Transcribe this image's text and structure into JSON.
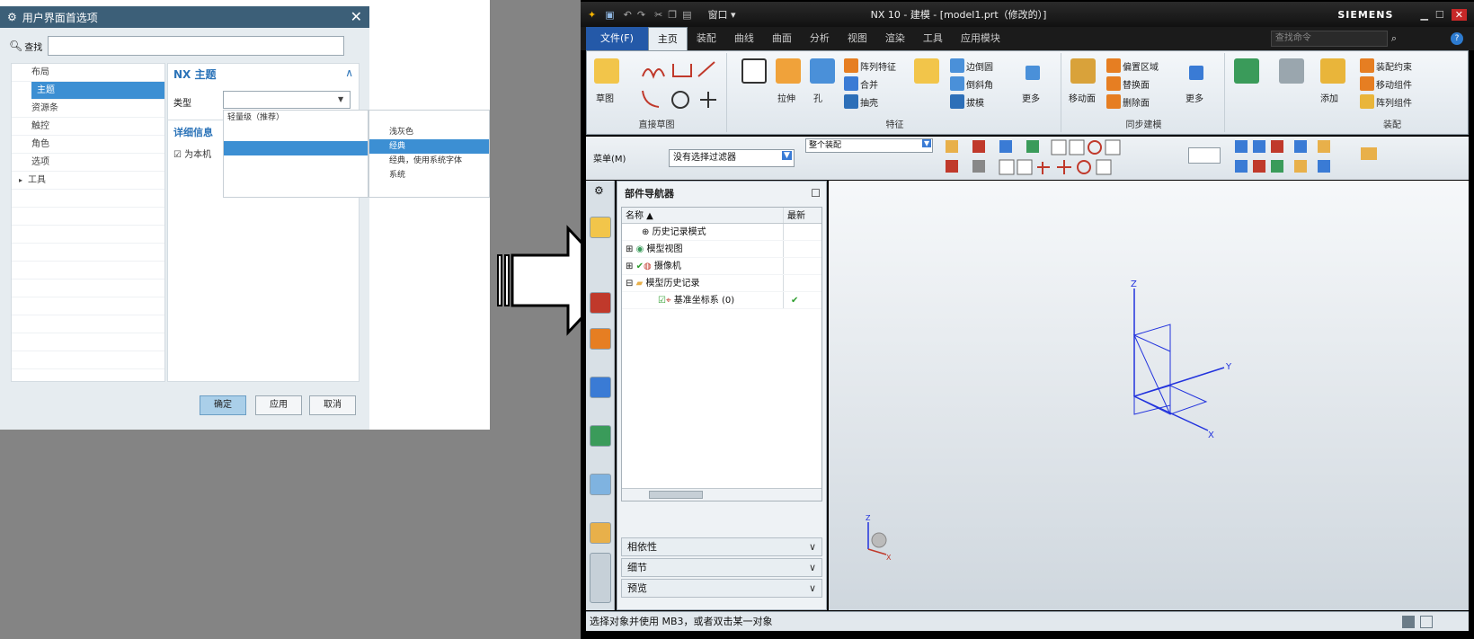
{
  "dialog": {
    "title": "用户界面首选项",
    "search_label": "查找",
    "search_value": "",
    "nav_items": [
      "布局",
      "主题",
      "资源条",
      "触控",
      "角色",
      "选项",
      "工具"
    ],
    "selected_nav": "主题",
    "section_title": "NX 主题",
    "type_label": "类型",
    "type_value": "",
    "popup_items_left": [
      "轻量级（推荐）"
    ],
    "popup_items_right": [
      "浅灰色",
      "经典",
      "经典，使用系统字体",
      "系统"
    ],
    "popup_highlight": "经典",
    "section2_title": "详细信息",
    "section2_text": "为本机",
    "ok_label": "确定",
    "apply_label": "应用",
    "cancel_label": "取消"
  },
  "nx": {
    "window_title": "NX 10 - 建模 - [model1.prt（修改的）]",
    "brand": "SIEMENS",
    "window_menu_label": "窗口",
    "search_placeholder": "查找命令",
    "tabs": [
      "文件(F)",
      "主页",
      "装配",
      "曲线",
      "曲面",
      "分析",
      "视图",
      "渲染",
      "工具",
      "应用模块"
    ],
    "active_tab": "主页",
    "groups": [
      {
        "label": "直接草图",
        "items": [
          "草图"
        ]
      },
      {
        "label": "特征",
        "items": [
          "拉伸",
          "孔",
          "阵列特征",
          "合并",
          "抽壳",
          "边倒圆",
          "倒斜角",
          "拔模",
          "更多"
        ]
      },
      {
        "label": "同步建模",
        "items": [
          "移动面",
          "偏置区域",
          "替换面",
          "删除面",
          "更多"
        ]
      },
      {
        "label": "装配",
        "items": [
          "添加",
          "装配约束",
          "移动组件",
          "阵列组件"
        ]
      }
    ],
    "menu_label": "菜单(M)",
    "filter_value": "没有选择过滤器",
    "assembly_scope": "整个装配",
    "navigator": {
      "title": "部件导航器",
      "col_name": "名称",
      "col_latest": "最新",
      "rows": [
        {
          "label": "历史记录模式",
          "latest": ""
        },
        {
          "label": "模型视图",
          "latest": ""
        },
        {
          "label": "摄像机",
          "latest": ""
        },
        {
          "label": "模型历史记录",
          "latest": ""
        },
        {
          "label": "基准坐标系 (0)",
          "latest": "✔"
        }
      ],
      "accordions": [
        "相依性",
        "细节",
        "预览"
      ]
    },
    "status_text": "选择对象并使用 MB3，或者双击某一对象"
  }
}
